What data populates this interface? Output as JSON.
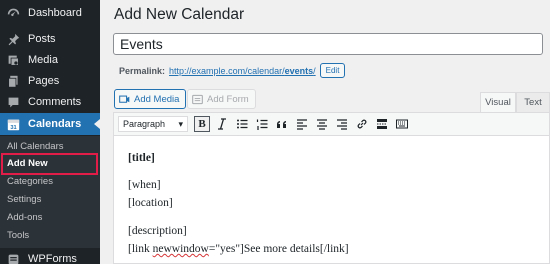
{
  "sidebar": {
    "items": [
      {
        "label": "Dashboard",
        "icon": "dashboard-icon"
      },
      {
        "label": "Posts",
        "icon": "pushpin-icon"
      },
      {
        "label": "Media",
        "icon": "media-icon"
      },
      {
        "label": "Pages",
        "icon": "pages-icon"
      },
      {
        "label": "Comments",
        "icon": "comments-icon"
      },
      {
        "label": "Calendars",
        "icon": "calendar-icon"
      },
      {
        "label": "WPForms",
        "icon": "wpforms-icon"
      }
    ],
    "calendars_badge": "31",
    "submenu": [
      "All Calendars",
      "Add New",
      "Categories",
      "Settings",
      "Add-ons",
      "Tools"
    ],
    "current_submenu": "Add New"
  },
  "page": {
    "title": "Add New Calendar",
    "post_title": "Events",
    "permalink_label": "Permalink:",
    "permalink_base": "http://example.com/calendar/",
    "permalink_slug": "events",
    "permalink_trail": "/",
    "edit_label": "Edit"
  },
  "editor": {
    "add_media": "Add Media",
    "add_form": "Add Form",
    "tab_visual": "Visual",
    "tab_text": "Text",
    "format_value": "Paragraph",
    "bold_label": "B",
    "content": {
      "title": "[title]",
      "when": "[when]",
      "location": "[location]",
      "description": "[description]",
      "link_pre": "[link ",
      "link_squiggle": "newwindow",
      "link_post": "=\"yes\"]See more details[/link]"
    }
  },
  "colors": {
    "sidebar_bg": "#1d2327",
    "active_blue": "#2271b1",
    "highlight_red": "#e11d48"
  }
}
